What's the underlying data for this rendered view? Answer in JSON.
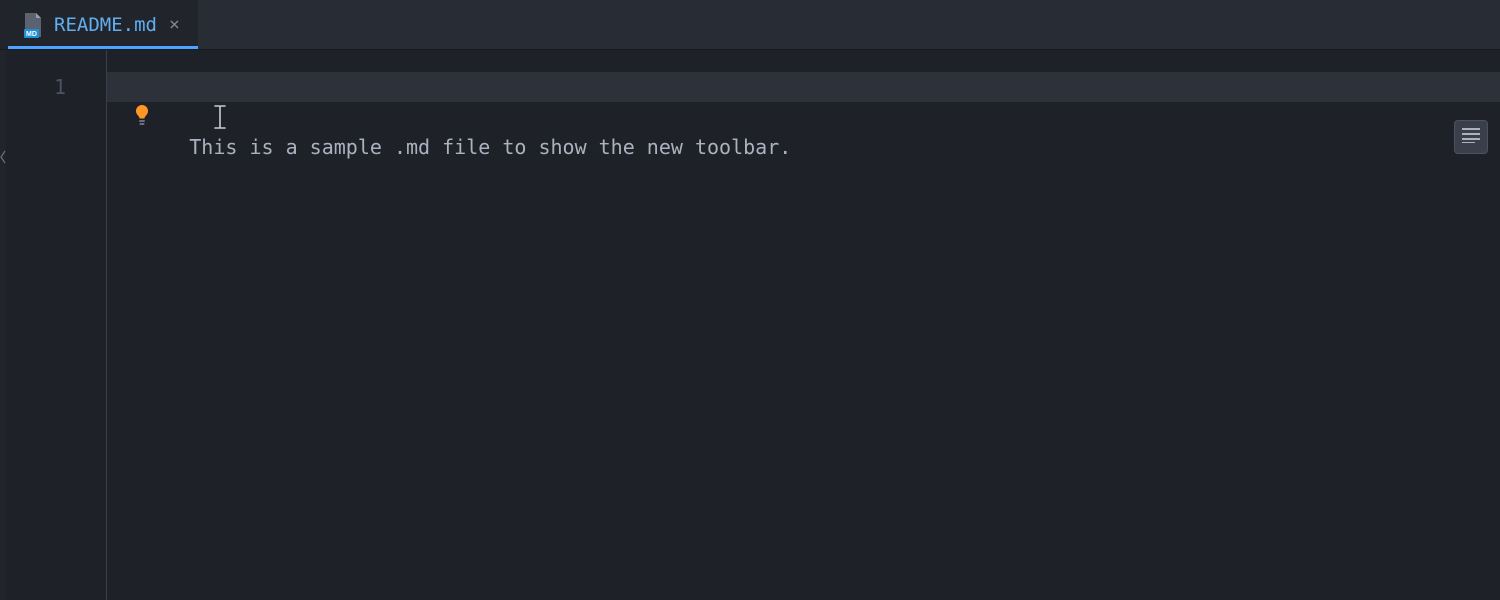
{
  "tab": {
    "filename": "README.md",
    "icon_badge": "MD",
    "active": true
  },
  "editor": {
    "lines": {
      "1": {
        "number": "1",
        "text": "This is a sample .md file to show the new toolbar."
      }
    },
    "cursor_on_line": 1
  },
  "icons": {
    "close": "×"
  }
}
